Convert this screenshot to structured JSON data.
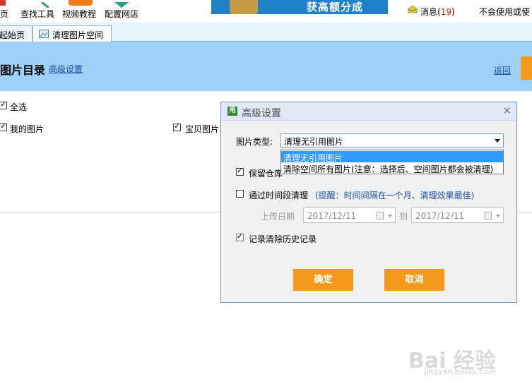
{
  "toolbar": {
    "items": [
      {
        "label": "页",
        "icon": "home-icon"
      },
      {
        "label": "查找工具",
        "icon": "search-tool-icon"
      },
      {
        "label": "视频教程",
        "icon": "video-icon"
      },
      {
        "label": "配置网店",
        "icon": "store-config-icon"
      }
    ],
    "banner_text": "获高额分成",
    "messages_label": "消息(",
    "messages_count": "19",
    "messages_close": ")",
    "right_text": "不会使用或使"
  },
  "tabs": [
    {
      "label": "起始页"
    },
    {
      "label": "清理图片空间"
    }
  ],
  "header": {
    "title": "图片目录",
    "advanced_link": "高级设置",
    "back_link": "返回"
  },
  "list": {
    "select_all": "全选",
    "my_images": "我的图片",
    "item_images": "宝贝图片"
  },
  "dialog": {
    "title": "高级设置",
    "icon_text": "甩",
    "close": "×",
    "image_type_label": "图片类型:",
    "image_type_value": "清理无引用图片",
    "dropdown_options": [
      "清理无引用图片",
      "清除空间所有图片(注意：选择后、空间图片都会被清理)"
    ],
    "keep_label": "保留仓库",
    "time_range_label": "通过时间段清理",
    "time_range_hint": "(提醒：时间间隔在一个月、清理效果最佳)",
    "upload_date_label": "上传日期",
    "date_from": "2017/12/11",
    "date_to_label": "到",
    "date_to": "2017/12/11",
    "record_history_label": "记录清除历史记录",
    "confirm_label": "确定",
    "cancel_label": "取消"
  },
  "watermark": {
    "main": "Bai 经验",
    "sub": "jingyan.baidu.com"
  },
  "colors": {
    "accent_orange": "#f39a1c",
    "header_blue": "#9fd0f7",
    "hint_blue": "#1a4fa6",
    "selection_blue": "#3399ff",
    "count_red": "#d81e06"
  }
}
